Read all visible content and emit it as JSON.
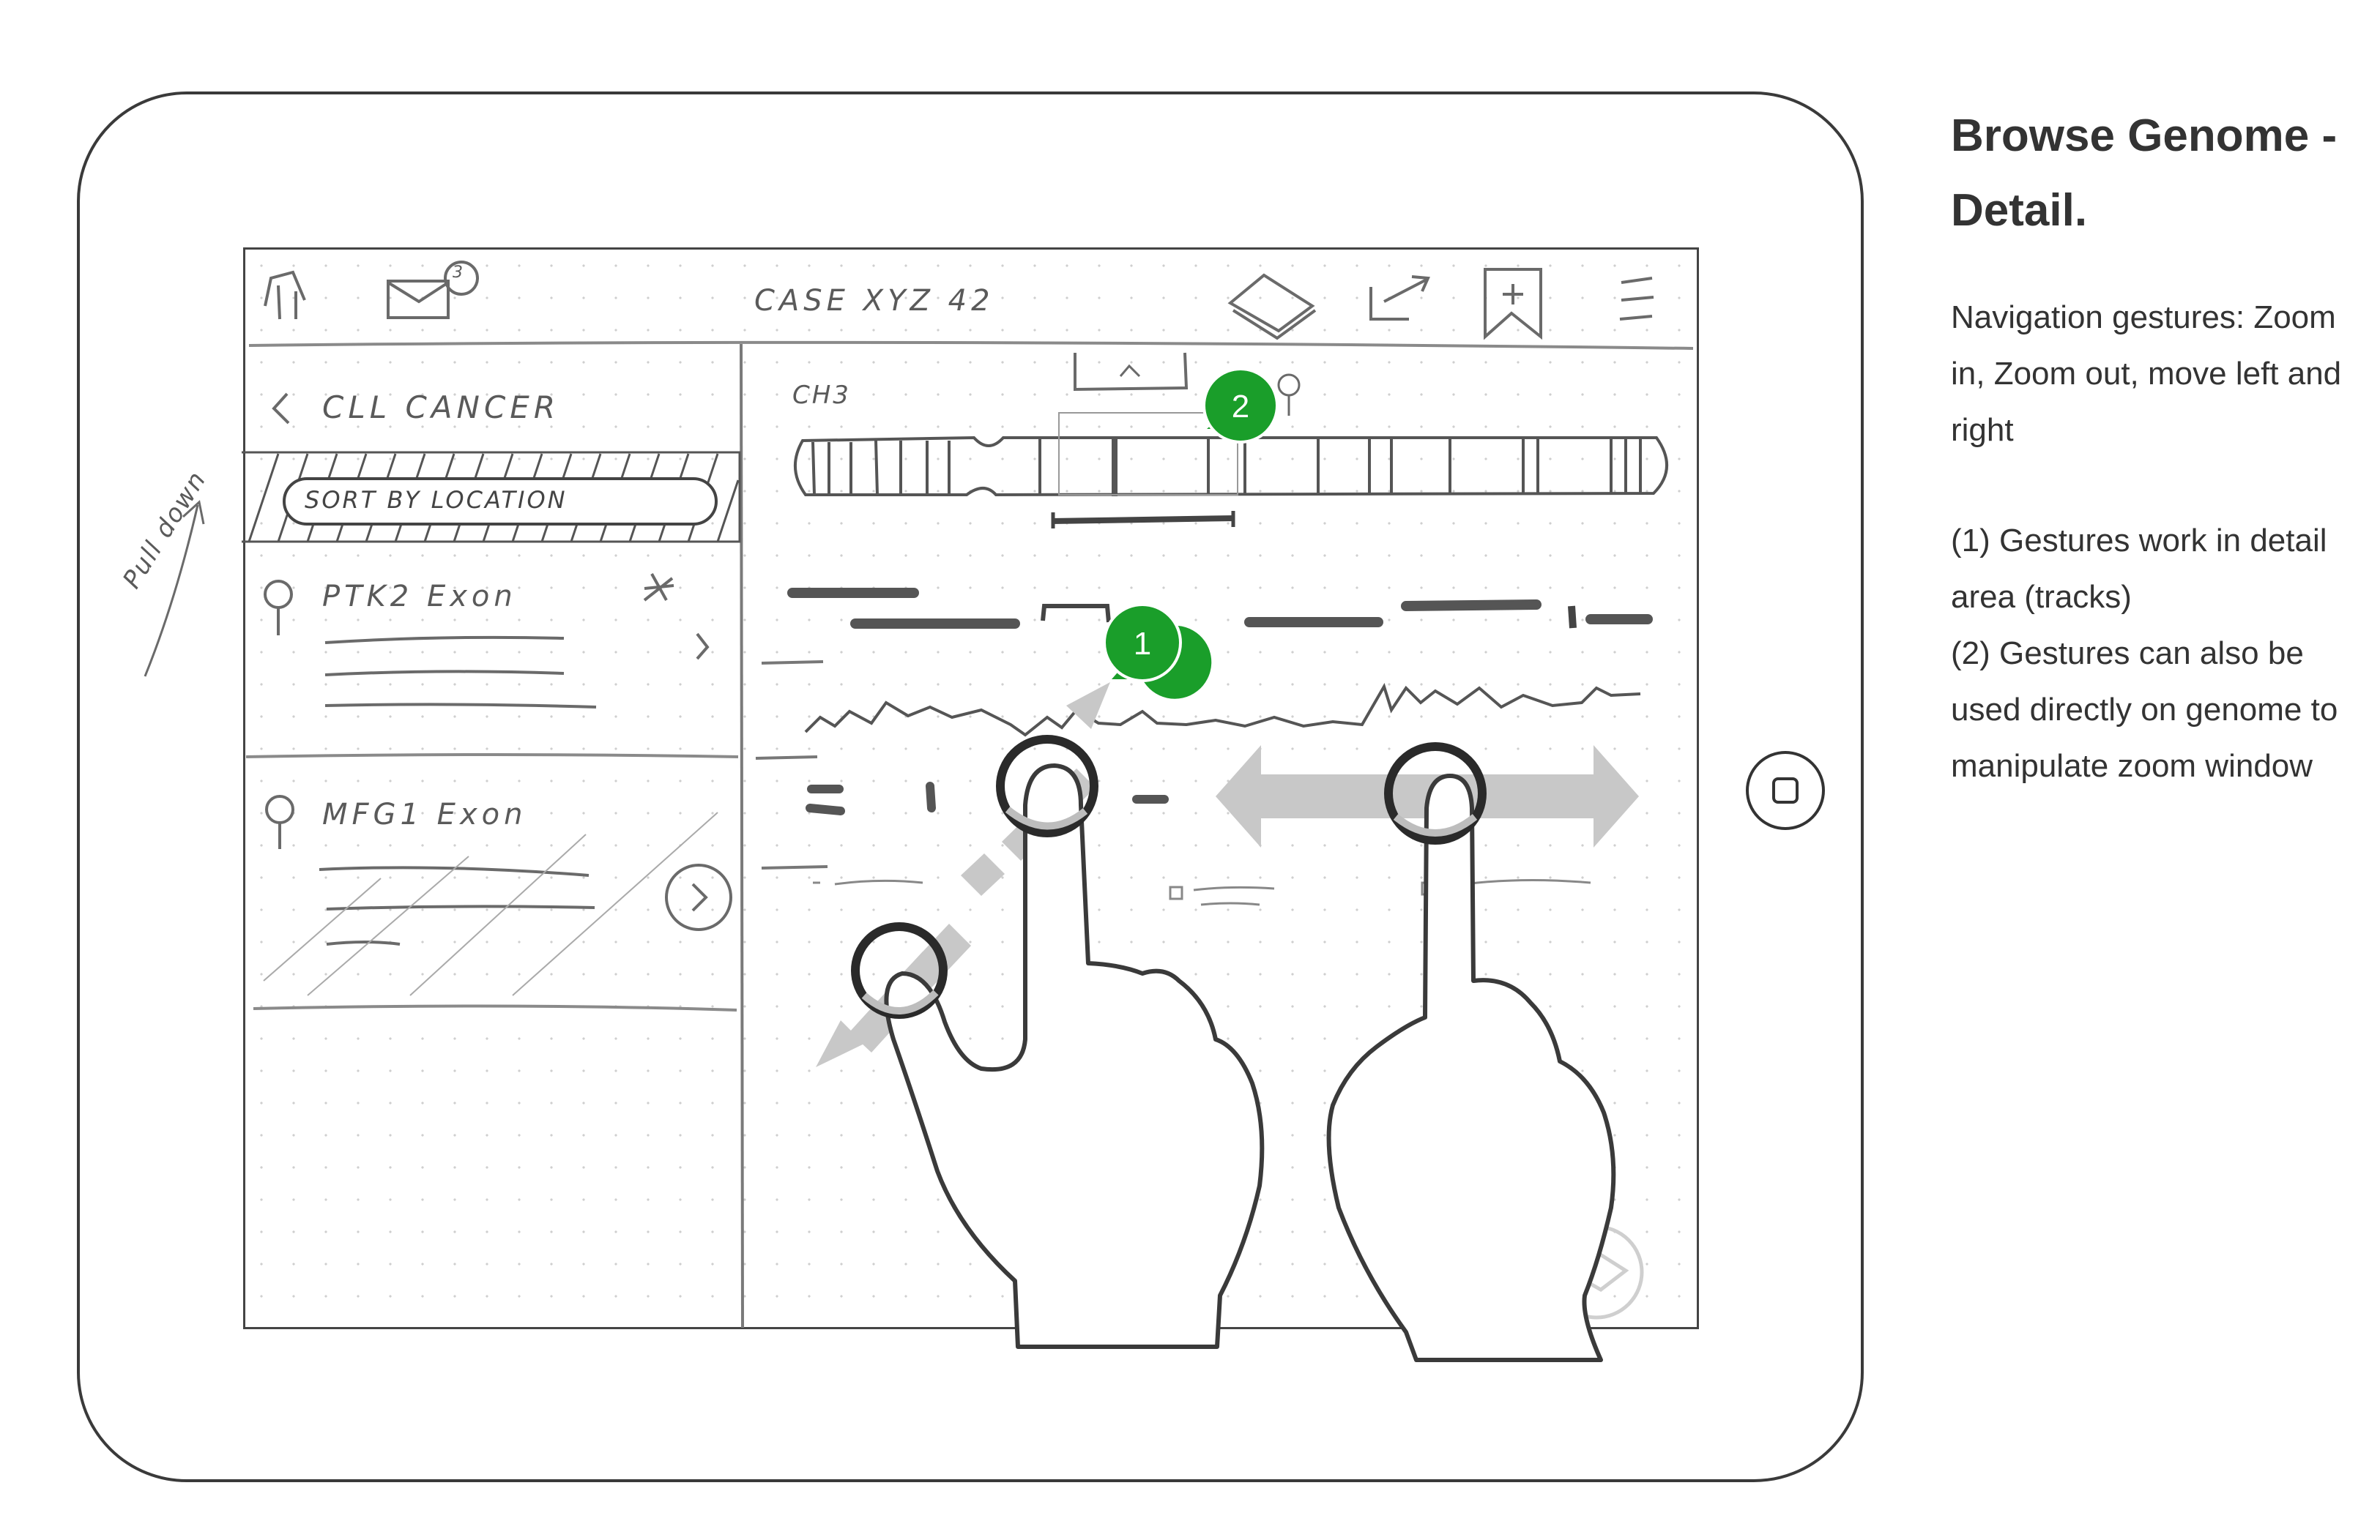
{
  "panel": {
    "title_line1": "Browse Genome -",
    "title_line2": "Detail.",
    "desc_lines": [
      "Navigation gestures: Zoom",
      "in, Zoom out, move left and",
      "right"
    ],
    "notes_lines": [
      "(1) Gestures work in detail",
      "area (tracks)",
      "(2) Gestures can also be",
      "used directly on genome to",
      "manipulate zoom window"
    ]
  },
  "sketch": {
    "header_title": "CASE XYZ 42",
    "mail_badge": "3",
    "back_label": "CLL CANCER",
    "sort_label": "SORT BY LOCATION",
    "pull_down_note": "Pull down",
    "list_items": [
      {
        "label": "PTK2 Exon"
      },
      {
        "label": "MFG1 Exon"
      }
    ],
    "chromosome_label": "CH3"
  },
  "callouts": {
    "one": "1",
    "two": "2"
  },
  "colors": {
    "callout_green": "#1a9e2a",
    "arrow_gray": "#c8c8c8",
    "frame": "#3a3a3a"
  },
  "icons": [
    "home-icon",
    "mail-icon",
    "notebook-icon",
    "share-icon",
    "bookmark-add-icon",
    "menu-icon",
    "chevron-right-icon",
    "pin-icon",
    "star-icon",
    "home-button-icon"
  ]
}
